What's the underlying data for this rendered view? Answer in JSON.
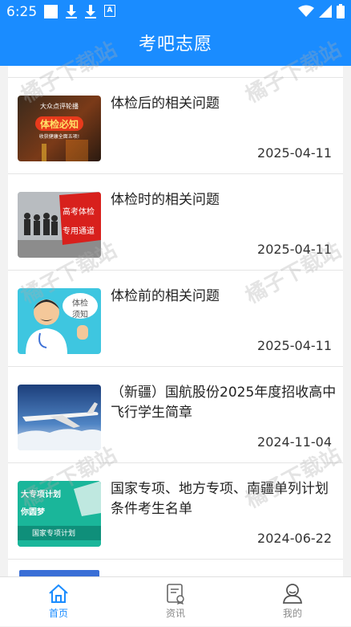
{
  "status_bar": {
    "time": "6:25",
    "badge_letter": "A"
  },
  "header": {
    "title": "考吧志愿"
  },
  "articles": [
    {
      "title": "体检后的相关问题",
      "date": "2025-04-11",
      "thumb_lines": [
        "大众点评轮播",
        "体检必知",
        "收获健康全面五项!"
      ]
    },
    {
      "title": "体检时的相关问题",
      "date": "2025-04-11",
      "thumb_lines": [
        "高考体检",
        "专用通道"
      ]
    },
    {
      "title": "体检前的相关问题",
      "date": "2025-04-11",
      "thumb_lines": [
        "体检",
        "须知"
      ]
    },
    {
      "title": "（新疆）国航股份2025年度招收高中飞行学生简章",
      "date": "2024-11-04"
    },
    {
      "title": "国家专项、地方专项、南疆单列计划条件考生名单",
      "date": "2024-06-22",
      "thumb_lines": [
        "大专项计划",
        "你圆梦",
        "国家专项计划"
      ]
    }
  ],
  "watermark_text": "橘子下载站",
  "tabbar": [
    {
      "label": "首页",
      "icon": "home-icon",
      "active": true
    },
    {
      "label": "资讯",
      "icon": "news-icon",
      "active": false
    },
    {
      "label": "我的",
      "icon": "user-icon",
      "active": false
    }
  ],
  "colors": {
    "brand": "#1a8cff",
    "tab_inactive": "#8a8a8a"
  }
}
